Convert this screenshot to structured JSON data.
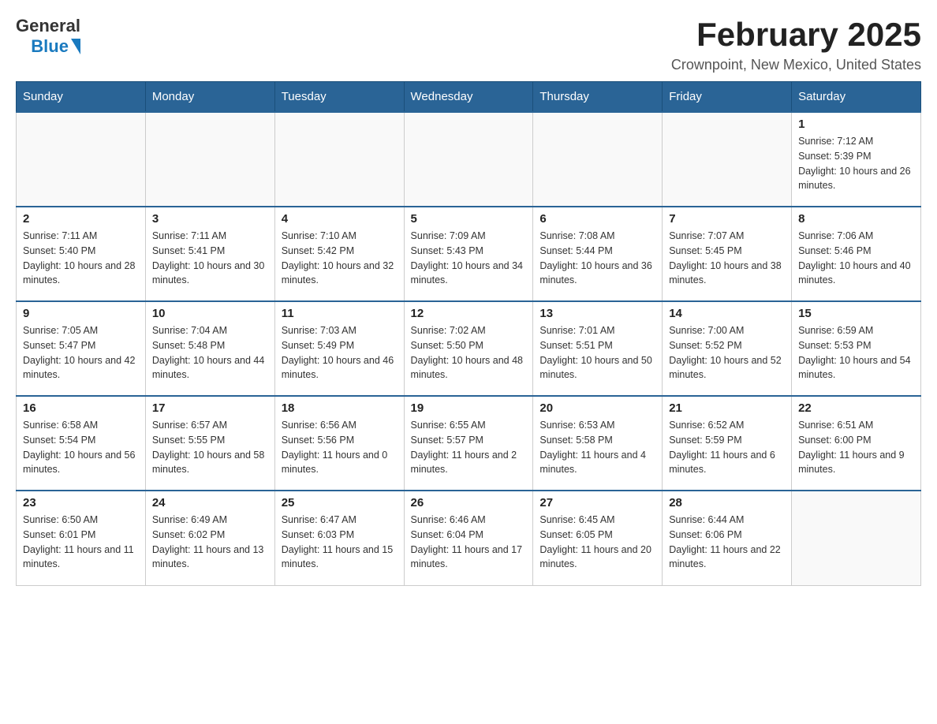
{
  "header": {
    "logo_text_general": "General",
    "logo_text_blue": "Blue",
    "month_title": "February 2025",
    "location": "Crownpoint, New Mexico, United States"
  },
  "days_of_week": [
    "Sunday",
    "Monday",
    "Tuesday",
    "Wednesday",
    "Thursday",
    "Friday",
    "Saturday"
  ],
  "weeks": [
    [
      {
        "day": "",
        "sunrise": "",
        "sunset": "",
        "daylight": ""
      },
      {
        "day": "",
        "sunrise": "",
        "sunset": "",
        "daylight": ""
      },
      {
        "day": "",
        "sunrise": "",
        "sunset": "",
        "daylight": ""
      },
      {
        "day": "",
        "sunrise": "",
        "sunset": "",
        "daylight": ""
      },
      {
        "day": "",
        "sunrise": "",
        "sunset": "",
        "daylight": ""
      },
      {
        "day": "",
        "sunrise": "",
        "sunset": "",
        "daylight": ""
      },
      {
        "day": "1",
        "sunrise": "Sunrise: 7:12 AM",
        "sunset": "Sunset: 5:39 PM",
        "daylight": "Daylight: 10 hours and 26 minutes."
      }
    ],
    [
      {
        "day": "2",
        "sunrise": "Sunrise: 7:11 AM",
        "sunset": "Sunset: 5:40 PM",
        "daylight": "Daylight: 10 hours and 28 minutes."
      },
      {
        "day": "3",
        "sunrise": "Sunrise: 7:11 AM",
        "sunset": "Sunset: 5:41 PM",
        "daylight": "Daylight: 10 hours and 30 minutes."
      },
      {
        "day": "4",
        "sunrise": "Sunrise: 7:10 AM",
        "sunset": "Sunset: 5:42 PM",
        "daylight": "Daylight: 10 hours and 32 minutes."
      },
      {
        "day": "5",
        "sunrise": "Sunrise: 7:09 AM",
        "sunset": "Sunset: 5:43 PM",
        "daylight": "Daylight: 10 hours and 34 minutes."
      },
      {
        "day": "6",
        "sunrise": "Sunrise: 7:08 AM",
        "sunset": "Sunset: 5:44 PM",
        "daylight": "Daylight: 10 hours and 36 minutes."
      },
      {
        "day": "7",
        "sunrise": "Sunrise: 7:07 AM",
        "sunset": "Sunset: 5:45 PM",
        "daylight": "Daylight: 10 hours and 38 minutes."
      },
      {
        "day": "8",
        "sunrise": "Sunrise: 7:06 AM",
        "sunset": "Sunset: 5:46 PM",
        "daylight": "Daylight: 10 hours and 40 minutes."
      }
    ],
    [
      {
        "day": "9",
        "sunrise": "Sunrise: 7:05 AM",
        "sunset": "Sunset: 5:47 PM",
        "daylight": "Daylight: 10 hours and 42 minutes."
      },
      {
        "day": "10",
        "sunrise": "Sunrise: 7:04 AM",
        "sunset": "Sunset: 5:48 PM",
        "daylight": "Daylight: 10 hours and 44 minutes."
      },
      {
        "day": "11",
        "sunrise": "Sunrise: 7:03 AM",
        "sunset": "Sunset: 5:49 PM",
        "daylight": "Daylight: 10 hours and 46 minutes."
      },
      {
        "day": "12",
        "sunrise": "Sunrise: 7:02 AM",
        "sunset": "Sunset: 5:50 PM",
        "daylight": "Daylight: 10 hours and 48 minutes."
      },
      {
        "day": "13",
        "sunrise": "Sunrise: 7:01 AM",
        "sunset": "Sunset: 5:51 PM",
        "daylight": "Daylight: 10 hours and 50 minutes."
      },
      {
        "day": "14",
        "sunrise": "Sunrise: 7:00 AM",
        "sunset": "Sunset: 5:52 PM",
        "daylight": "Daylight: 10 hours and 52 minutes."
      },
      {
        "day": "15",
        "sunrise": "Sunrise: 6:59 AM",
        "sunset": "Sunset: 5:53 PM",
        "daylight": "Daylight: 10 hours and 54 minutes."
      }
    ],
    [
      {
        "day": "16",
        "sunrise": "Sunrise: 6:58 AM",
        "sunset": "Sunset: 5:54 PM",
        "daylight": "Daylight: 10 hours and 56 minutes."
      },
      {
        "day": "17",
        "sunrise": "Sunrise: 6:57 AM",
        "sunset": "Sunset: 5:55 PM",
        "daylight": "Daylight: 10 hours and 58 minutes."
      },
      {
        "day": "18",
        "sunrise": "Sunrise: 6:56 AM",
        "sunset": "Sunset: 5:56 PM",
        "daylight": "Daylight: 11 hours and 0 minutes."
      },
      {
        "day": "19",
        "sunrise": "Sunrise: 6:55 AM",
        "sunset": "Sunset: 5:57 PM",
        "daylight": "Daylight: 11 hours and 2 minutes."
      },
      {
        "day": "20",
        "sunrise": "Sunrise: 6:53 AM",
        "sunset": "Sunset: 5:58 PM",
        "daylight": "Daylight: 11 hours and 4 minutes."
      },
      {
        "day": "21",
        "sunrise": "Sunrise: 6:52 AM",
        "sunset": "Sunset: 5:59 PM",
        "daylight": "Daylight: 11 hours and 6 minutes."
      },
      {
        "day": "22",
        "sunrise": "Sunrise: 6:51 AM",
        "sunset": "Sunset: 6:00 PM",
        "daylight": "Daylight: 11 hours and 9 minutes."
      }
    ],
    [
      {
        "day": "23",
        "sunrise": "Sunrise: 6:50 AM",
        "sunset": "Sunset: 6:01 PM",
        "daylight": "Daylight: 11 hours and 11 minutes."
      },
      {
        "day": "24",
        "sunrise": "Sunrise: 6:49 AM",
        "sunset": "Sunset: 6:02 PM",
        "daylight": "Daylight: 11 hours and 13 minutes."
      },
      {
        "day": "25",
        "sunrise": "Sunrise: 6:47 AM",
        "sunset": "Sunset: 6:03 PM",
        "daylight": "Daylight: 11 hours and 15 minutes."
      },
      {
        "day": "26",
        "sunrise": "Sunrise: 6:46 AM",
        "sunset": "Sunset: 6:04 PM",
        "daylight": "Daylight: 11 hours and 17 minutes."
      },
      {
        "day": "27",
        "sunrise": "Sunrise: 6:45 AM",
        "sunset": "Sunset: 6:05 PM",
        "daylight": "Daylight: 11 hours and 20 minutes."
      },
      {
        "day": "28",
        "sunrise": "Sunrise: 6:44 AM",
        "sunset": "Sunset: 6:06 PM",
        "daylight": "Daylight: 11 hours and 22 minutes."
      },
      {
        "day": "",
        "sunrise": "",
        "sunset": "",
        "daylight": ""
      }
    ]
  ]
}
